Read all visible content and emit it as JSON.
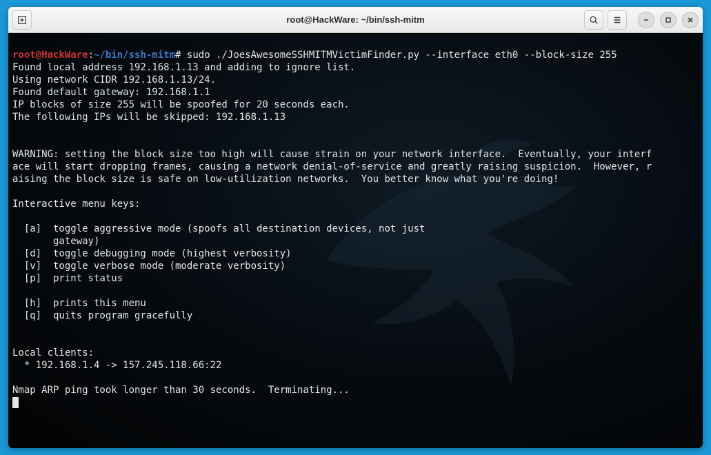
{
  "window": {
    "title": "root@HackWare: ~/bin/ssh-mitm"
  },
  "titlebar": {
    "new_tab_tooltip": "New Tab",
    "search_tooltip": "Search",
    "menu_tooltip": "Menu",
    "minimize_tooltip": "Minimize",
    "maximize_tooltip": "Maximize",
    "close_tooltip": "Close"
  },
  "prompt": {
    "user_host": "root@HackWare",
    "path": "~/bin/ssh-mitm",
    "symbol": "#",
    "command": "sudo ./JoesAwesomeSSHMITMVictimFinder.py --interface eth0 --block-size 255"
  },
  "output": {
    "line1": "Found local address 192.168.1.13 and adding to ignore list.",
    "line2": "Using network CIDR 192.168.1.13/24.",
    "line3": "Found default gateway: 192.168.1.1",
    "line4": "IP blocks of size 255 will be spoofed for 20 seconds each.",
    "line5": "The following IPs will be skipped: 192.168.1.13",
    "warn1": "WARNING: setting the block size too high will cause strain on your network interface.  Eventually, your interf",
    "warn2": "ace will start dropping frames, causing a network denial-of-service and greatly raising suspicion.  However, r",
    "warn3": "aising the block size is safe on low-utilization networks.  You better know what you're doing!",
    "menu_header": "Interactive menu keys:",
    "menu_a1": "  [a]  toggle aggressive mode (spoofs all destination devices, not just",
    "menu_a2": "       gateway)",
    "menu_d": "  [d]  toggle debugging mode (highest verbosity)",
    "menu_v": "  [v]  toggle verbose mode (moderate verbosity)",
    "menu_p": "  [p]  print status",
    "menu_h": "  [h]  prints this menu",
    "menu_q": "  [q]  quits program gracefully",
    "clients_header": "Local clients:",
    "client1": "  * 192.168.1.4 -> 157.245.118.66:22",
    "nmap": "Nmap ARP ping took longer than 30 seconds.  Terminating..."
  }
}
